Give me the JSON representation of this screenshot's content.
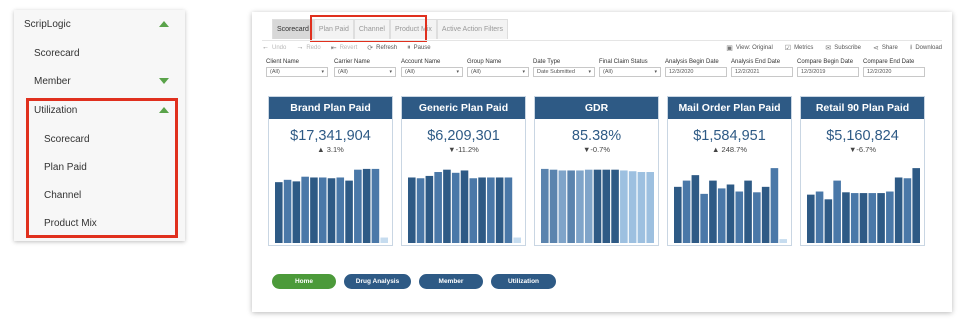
{
  "nav": {
    "header": {
      "label": "ScripLogic"
    },
    "items": [
      {
        "label": "Scorecard"
      },
      {
        "label": "Member"
      },
      {
        "label": "Utilization"
      }
    ],
    "sub_items": [
      {
        "label": "Scorecard"
      },
      {
        "label": "Plan Paid"
      },
      {
        "label": "Channel"
      },
      {
        "label": "Product Mix"
      }
    ],
    "icons": {
      "expanded": "triangle-up-icon",
      "collapsed": "triangle-down-icon"
    },
    "highlight_color": "#e0301e"
  },
  "tabs": [
    {
      "label": "Scorecard",
      "active": true
    },
    {
      "label": "Plan Paid",
      "active": false
    },
    {
      "label": "Channel",
      "active": false
    },
    {
      "label": "Product Mix",
      "active": false
    },
    {
      "label": "Active Action Filters",
      "active": false
    }
  ],
  "toolbar": {
    "undo": "Undo",
    "redo": "Redo",
    "revert": "Revert",
    "refresh": "Refresh",
    "pause": "Pause",
    "view": "View: Original",
    "metrics": "Metrics",
    "subscribe": "Subscribe",
    "share": "Share",
    "download": "Download"
  },
  "filters": [
    {
      "label": "Client Name",
      "value": "(All)"
    },
    {
      "label": "Carrier Name",
      "value": "(All)"
    },
    {
      "label": "Account Name",
      "value": "(All)"
    },
    {
      "label": "Group Name",
      "value": "(All)"
    },
    {
      "label": "Date Type",
      "value": "Date Submitted"
    },
    {
      "label": "Final Claim Status",
      "value": "(All)"
    },
    {
      "label": "Analysis Begin Date",
      "value": "12/3/2020"
    },
    {
      "label": "Analysis End Date",
      "value": "12/2/2021"
    },
    {
      "label": "Compare Begin Date",
      "value": "12/3/2019"
    },
    {
      "label": "Compare End Date",
      "value": "12/2/2020"
    }
  ],
  "cards": [
    {
      "title": "Brand Plan Paid",
      "value": "$17,341,904",
      "arrow": "▲",
      "change": "3.1%"
    },
    {
      "title": "Generic Plan Paid",
      "value": "$6,209,301",
      "arrow": "▼",
      "change": "-11.2%"
    },
    {
      "title": "GDR",
      "value": "85.38%",
      "arrow": "▼",
      "change": "-0.7%"
    },
    {
      "title": "Mail Order Plan Paid",
      "value": "$1,584,951",
      "arrow": "▲",
      "change": "248.7%"
    },
    {
      "title": "Retail 90 Plan Paid",
      "value": "$5,160,824",
      "arrow": "▼",
      "change": "-6.7%"
    }
  ],
  "buttons": [
    {
      "label": "Home",
      "color": "#4c9a3a"
    },
    {
      "label": "Drug Analysis",
      "color": "#2e5a85"
    },
    {
      "label": "Member",
      "color": "#2e5a85"
    },
    {
      "label": "Utilization",
      "color": "#2e5a85"
    }
  ],
  "colors": {
    "card_header": "#2e5a85",
    "bar_dark": "#2e5a85",
    "bar_mid": "#4a78a8",
    "bar_light": "#9dc0e0",
    "bar_pale": "#c6dcef"
  },
  "chart_data": [
    {
      "type": "bar",
      "name": "Brand Plan Paid",
      "values": [
        0.78,
        0.81,
        0.79,
        0.85,
        0.84,
        0.84,
        0.83,
        0.84,
        0.8,
        0.94,
        0.95,
        0.95,
        0.07
      ]
    },
    {
      "type": "bar",
      "name": "Generic Plan Paid",
      "values": [
        0.84,
        0.83,
        0.86,
        0.91,
        0.94,
        0.9,
        0.93,
        0.83,
        0.84,
        0.84,
        0.84,
        0.84,
        0.07
      ]
    },
    {
      "type": "bar",
      "name": "GDR",
      "values": [
        0.95,
        0.94,
        0.93,
        0.93,
        0.93,
        0.94,
        0.94,
        0.94,
        0.94,
        0.93,
        0.92,
        0.91,
        0.91
      ]
    },
    {
      "type": "bar",
      "name": "Mail Order Plan Paid",
      "values": [
        0.72,
        0.8,
        0.87,
        0.63,
        0.8,
        0.7,
        0.75,
        0.66,
        0.8,
        0.65,
        0.72,
        0.96,
        0.05
      ]
    },
    {
      "type": "bar",
      "name": "Retail 90 Plan Paid",
      "values": [
        0.62,
        0.66,
        0.56,
        0.8,
        0.65,
        0.64,
        0.64,
        0.64,
        0.64,
        0.66,
        0.84,
        0.83,
        0.96
      ]
    }
  ]
}
